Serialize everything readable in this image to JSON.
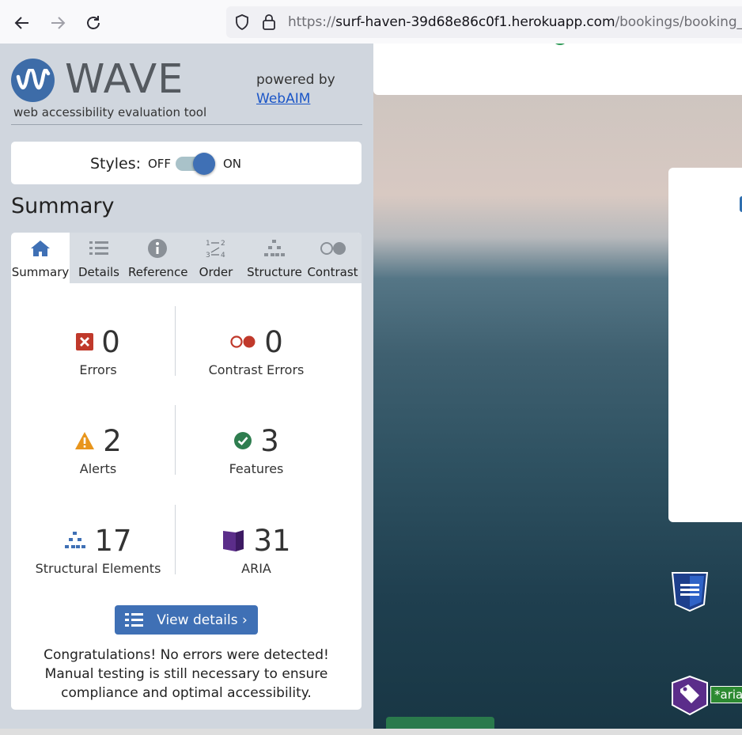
{
  "browser": {
    "url_scheme": "https://",
    "url_host": "surf-haven-39d68e86c0f1.herokuapp.com",
    "url_path": "/bookings/booking_list/"
  },
  "wave": {
    "logo_text": "WAVE",
    "tagline": "web accessibility evaluation tool",
    "powered_by": "powered by",
    "webaim_link": "WebAIM",
    "styles_label": "Styles:",
    "styles_off": "OFF",
    "styles_on": "ON",
    "styles_state": "on",
    "summary_heading": "Summary",
    "tabs": [
      {
        "label": "Summary",
        "icon": "home-icon",
        "active": true
      },
      {
        "label": "Details",
        "icon": "list-icon",
        "active": false
      },
      {
        "label": "Reference",
        "icon": "info-icon",
        "active": false
      },
      {
        "label": "Order",
        "icon": "order-icon",
        "active": false
      },
      {
        "label": "Structure",
        "icon": "structure-icon",
        "active": false
      },
      {
        "label": "Contrast",
        "icon": "contrast-icon",
        "active": false
      }
    ],
    "stats": {
      "errors": {
        "count": "0",
        "label": "Errors",
        "icon": "error-icon",
        "color": "#c0392b"
      },
      "contrast_errors": {
        "count": "0",
        "label": "Contrast Errors",
        "icon": "contrast-error-icon",
        "color": "#c0392b"
      },
      "alerts": {
        "count": "2",
        "label": "Alerts",
        "icon": "alert-icon",
        "color": "#e8951c"
      },
      "features": {
        "count": "3",
        "label": "Features",
        "icon": "feature-icon",
        "color": "#2e7d4f"
      },
      "structural": {
        "count": "17",
        "label": "Structural Elements",
        "icon": "structure-icon",
        "color": "#3f70b5"
      },
      "aria": {
        "count": "31",
        "label": "ARIA",
        "icon": "aria-icon",
        "color": "#5b2d8a"
      }
    },
    "view_details": "View details ›",
    "congrats": "Congratulations! No errors were detected! Manual testing is still necessary to ensure compliance and optimal accessibility."
  },
  "page": {
    "aria_label_fragment": "*aria-"
  }
}
